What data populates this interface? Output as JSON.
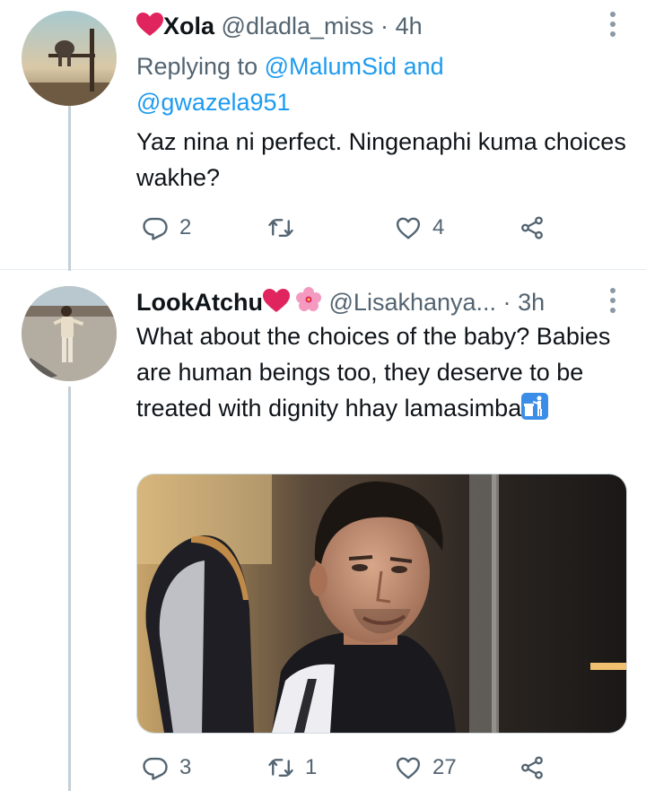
{
  "tweet1": {
    "display_name": "Xola",
    "handle": "@dladla_miss",
    "separator": "·",
    "time": "4h",
    "reply_prefix": "Replying to",
    "reply_user1": "@MalumSid",
    "reply_and": "and",
    "reply_user2": "@gwazela951",
    "text": "Yaz nina ni perfect. Ningenaphi kuma choices wakhe?",
    "replies": "2",
    "likes": "4",
    "colors": {
      "heart": "#e0245e"
    }
  },
  "tweet2": {
    "display_name": "LookAtchu",
    "handle": "@Lisakhanya...",
    "separator": "·",
    "time": "3h",
    "text": "What about the choices of the baby? Babies are human beings too, they deserve to be treated with dignity hhay lamasimba",
    "replies": "3",
    "retweets": "1",
    "likes": "27"
  },
  "icons": {
    "reply": "reply-icon",
    "retweet": "retweet-icon",
    "like": "heart-icon",
    "share": "share-icon",
    "more": "more-options-icon"
  },
  "colors": {
    "text": "#0f1419",
    "secondary": "#536471",
    "link": "#1d9bf0",
    "thread_line": "#c4cfd6"
  }
}
